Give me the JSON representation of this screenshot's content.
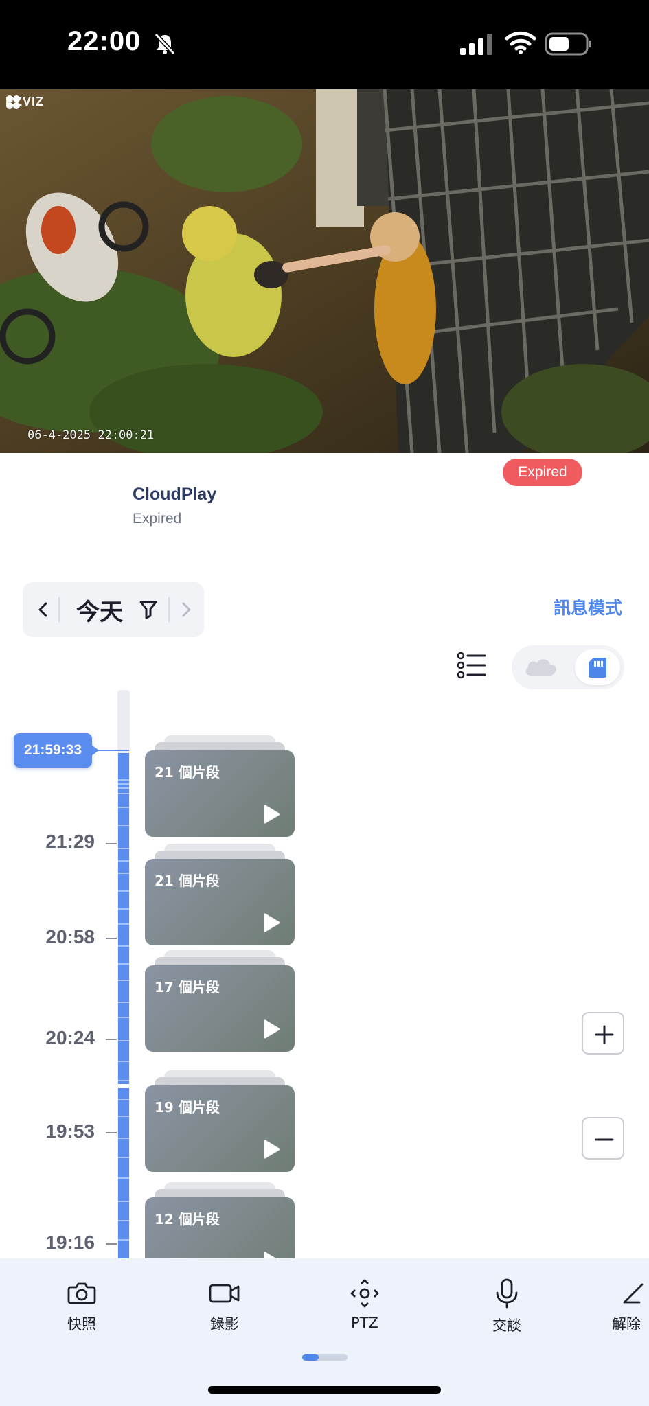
{
  "status_bar": {
    "time": "22:00"
  },
  "video": {
    "brand": "EZVIZ",
    "timestamp": "06-4-2025 22:00:21"
  },
  "cloudplay": {
    "badge": "Expired",
    "title": "CloudPlay",
    "subtitle": "Expired"
  },
  "date_nav": {
    "label": "今天"
  },
  "message_mode": "訊息模式",
  "timeline": {
    "current_time": "21:59:33",
    "ticks": [
      "21:29",
      "20:58",
      "20:24",
      "19:53",
      "19:16"
    ]
  },
  "clips": [
    "21 個片段",
    "21 個片段",
    "17 個片段",
    "19 個片段",
    "12 個片段"
  ],
  "toolbar": {
    "items": [
      {
        "label": "快照",
        "icon": "camera-icon"
      },
      {
        "label": "錄影",
        "icon": "video-camera-icon"
      },
      {
        "label": "PTZ",
        "icon": "ptz-icon"
      },
      {
        "label": "交談",
        "icon": "microphone-icon"
      },
      {
        "label": "解除",
        "icon": "unlock-icon"
      }
    ]
  },
  "colors": {
    "accent": "#4f86ea",
    "expired": "#ef5b5f",
    "timeline_fill": "#5b8cf0"
  }
}
